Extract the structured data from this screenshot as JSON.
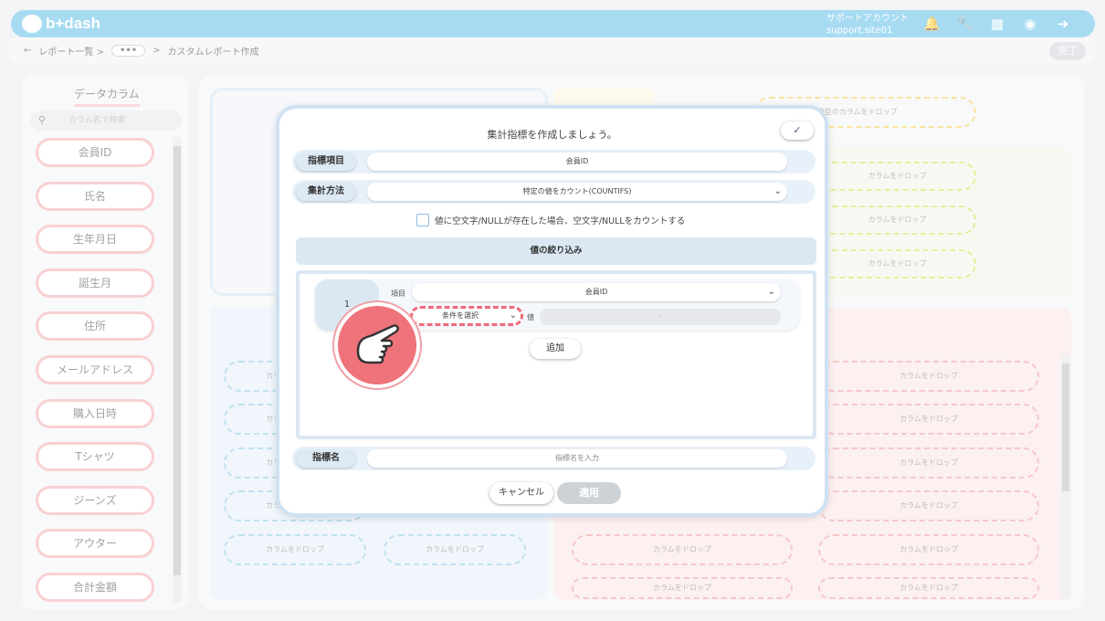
{
  "app": {
    "logo": "b+dash"
  },
  "header": {
    "account_name": "サポートアカウント",
    "account_site": "support.site01",
    "icons": [
      "bell-icon",
      "wrench-icon",
      "grid-icon",
      "chat-icon",
      "logout-icon"
    ]
  },
  "breadcrumb": {
    "back": "←",
    "report_list": "レポート一覧 >",
    "ellipsis": "•••",
    "separator": ">",
    "current": "カスタムレポート作成",
    "done_label": "完了"
  },
  "data_columns": {
    "title": "データカラム",
    "search_placeholder": "カラム名で検索",
    "items": [
      "会員ID",
      "氏名",
      "生年月日",
      "誕生月",
      "住所",
      "メールアドレス",
      "購入日時",
      "Tシャツ",
      "ジーンズ",
      "アウター",
      "合計金額"
    ]
  },
  "background": {
    "drop_label": "カラムをドロップ",
    "date_drop_label": "日付/日時型のカラムをドロップ"
  },
  "modal": {
    "title": "集計指標を作成しましょう。",
    "help_icon": "beginner-mark-icon",
    "metric_item_label": "指標項目",
    "metric_item_value": "会員ID",
    "agg_method_label": "集計方法",
    "agg_method_value": "特定の値をカウント(COUNTIFS)",
    "checkbox_text": "値に空文字/NULLが存在した場合、空文字/NULLをカウントする",
    "filter_title": "値の絞り込み",
    "condition": {
      "number": "1",
      "item_key": "項目",
      "item_value": "会員ID",
      "condition_placeholder": "条件を選択",
      "value_key": "値",
      "value_placeholder": "-"
    },
    "add_label": "追加",
    "metric_name_label": "指標名",
    "metric_name_placeholder": "指標名を入力",
    "cancel_label": "キャンセル",
    "apply_label": "適用"
  },
  "colors": {
    "header": "#5fbde8",
    "column_border": "#f4a9ae",
    "highlight_dash": "#ee6b78",
    "pointer_circle": "#ef737b"
  }
}
